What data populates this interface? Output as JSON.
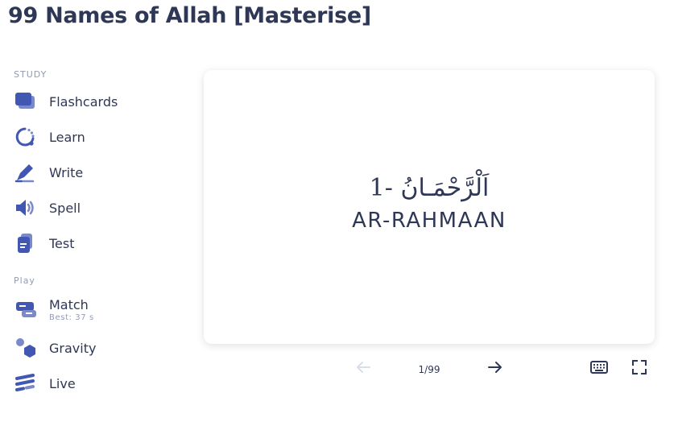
{
  "page": {
    "title": "99 Names of Allah [Masterise]"
  },
  "sidebar": {
    "study_label": "STUDY",
    "study_items": [
      {
        "label": "Flashcards",
        "icon": "flashcards-icon"
      },
      {
        "label": "Learn",
        "icon": "learn-icon"
      },
      {
        "label": "Write",
        "icon": "write-icon"
      },
      {
        "label": "Spell",
        "icon": "spell-icon"
      },
      {
        "label": "Test",
        "icon": "test-icon"
      }
    ],
    "play_label": "Play",
    "play_items": [
      {
        "label": "Match",
        "sub": "Best: 37 s",
        "icon": "match-icon"
      },
      {
        "label": "Gravity",
        "icon": "gravity-icon"
      },
      {
        "label": "Live",
        "icon": "live-icon"
      }
    ]
  },
  "card": {
    "front": "اَلْرَّحْمَـانُ -1",
    "back": "AR-RAHMAAN"
  },
  "controls": {
    "counter": "1/99"
  },
  "colors": {
    "accent": "#4257b2",
    "accent_light": "#7b89c9",
    "text": "#2e3856",
    "muted": "#939bb4"
  }
}
